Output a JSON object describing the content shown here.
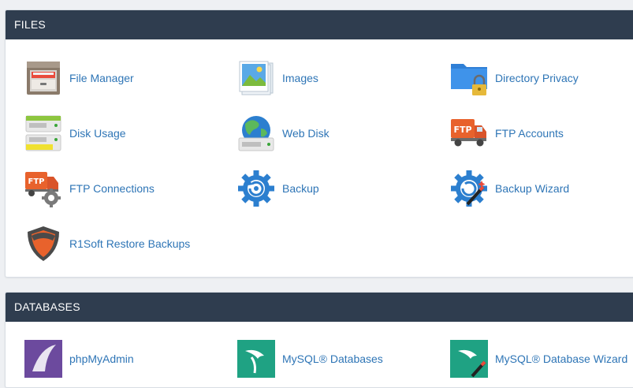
{
  "files": {
    "title": "FILES",
    "items": [
      {
        "label": "File Manager",
        "icon": "file-cabinet-icon"
      },
      {
        "label": "Images",
        "icon": "images-icon"
      },
      {
        "label": "Directory Privacy",
        "icon": "folder-lock-icon"
      },
      {
        "label": "Disk Usage",
        "icon": "disk-usage-icon"
      },
      {
        "label": "Web Disk",
        "icon": "web-disk-icon"
      },
      {
        "label": "FTP Accounts",
        "icon": "ftp-truck-icon"
      },
      {
        "label": "FTP Connections",
        "icon": "ftp-connections-icon"
      },
      {
        "label": "Backup",
        "icon": "backup-gear-icon"
      },
      {
        "label": "Backup Wizard",
        "icon": "backup-wizard-icon"
      },
      {
        "label": "R1Soft Restore Backups",
        "icon": "r1soft-shield-icon"
      }
    ]
  },
  "databases": {
    "title": "DATABASES",
    "items": [
      {
        "label": "phpMyAdmin",
        "icon": "phpmyadmin-icon"
      },
      {
        "label": "MySQL® Databases",
        "icon": "mysql-dolphin-icon"
      },
      {
        "label": "MySQL® Database Wizard",
        "icon": "mysql-wizard-icon"
      }
    ]
  },
  "colors": {
    "header_bg": "#2f3d4f",
    "link": "#2e75b6",
    "page_bg": "#eef0f3"
  }
}
